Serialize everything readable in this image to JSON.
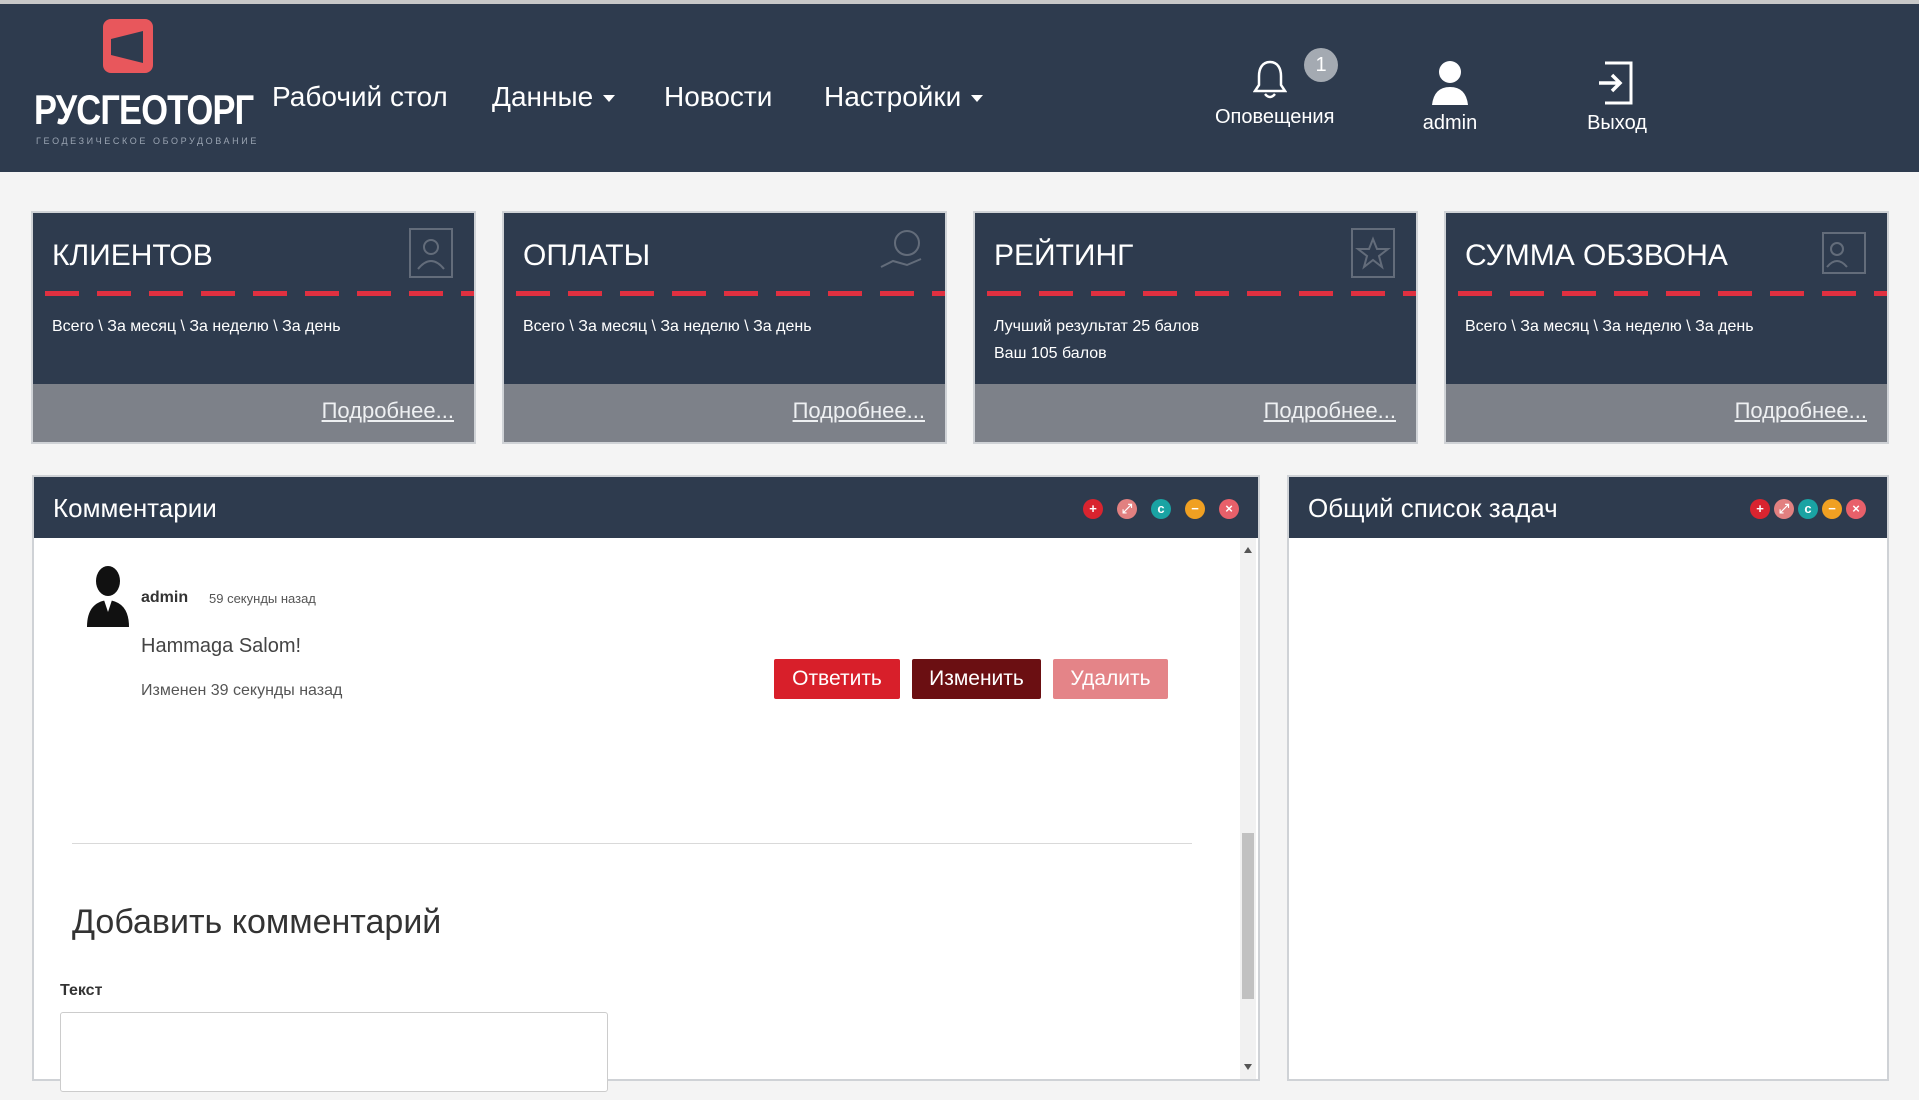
{
  "logo": {
    "text": "РУСГЕОТОРГ",
    "subtitle": "ГЕОДЕЗИЧЕСКОЕ ОБОРУДОВАНИЕ"
  },
  "nav": {
    "desktop": "Рабочий стол",
    "data": "Данные",
    "news": "Новости",
    "settings": "Настройки"
  },
  "header_actions": {
    "notifications": {
      "label": "Оповещения",
      "icon": "bell-icon",
      "count": "1"
    },
    "user": {
      "label": "admin",
      "icon": "user-icon"
    },
    "logout": {
      "label": "Выход",
      "icon": "logout-icon"
    }
  },
  "cards": [
    {
      "title": "КЛИЕНТОВ",
      "lines": [
        "Всего \\ За месяц \\ За неделю \\ За день"
      ],
      "link": "Подробнее...",
      "icon": "client-card-icon"
    },
    {
      "title": "ОПЛАТЫ",
      "lines": [
        "Всего \\ За месяц \\ За неделю \\ За день"
      ],
      "link": "Подробнее...",
      "icon": "money-icon"
    },
    {
      "title": "РЕЙТИНГ",
      "lines": [
        "Лучший результат 25 балов",
        "Ваш 105 балов"
      ],
      "link": "Подробнее...",
      "icon": "star-icon"
    },
    {
      "title": "СУММА ОБЗВОНА",
      "lines": [
        "Всего \\ За месяц \\ За неделю \\ За день"
      ],
      "link": "Подробнее...",
      "icon": "contact-card-icon"
    }
  ],
  "comments_panel": {
    "title": "Комментарии",
    "comment": {
      "author": "admin",
      "time": "59 секунды назад",
      "text": "Hammaga Salom!",
      "edited": "Изменен 39 секунды назад"
    },
    "buttons": {
      "reply": "Ответить",
      "edit": "Изменить",
      "delete": "Удалить"
    },
    "add_title": "Добавить комментарий",
    "field_label": "Текст"
  },
  "tasks_panel": {
    "title": "Общий список задач"
  },
  "panel_controls": [
    {
      "symbol": "+",
      "color": "#d9242f",
      "name": "add-control"
    },
    {
      "symbol": "⤢",
      "color": "#e28080",
      "name": "expand-control"
    },
    {
      "symbol": "c",
      "color": "#1aa3a3",
      "name": "refresh-control"
    },
    {
      "symbol": "−",
      "color": "#f0a022",
      "name": "minimize-control"
    },
    {
      "symbol": "×",
      "color": "#e8606a",
      "name": "close-control"
    }
  ],
  "colors": {
    "header": "#2e3b4e",
    "accent_red": "#d81f2a",
    "edit_button": "#6b0f12",
    "delete_button": "#e48488",
    "card_footer": "#7d8189"
  }
}
